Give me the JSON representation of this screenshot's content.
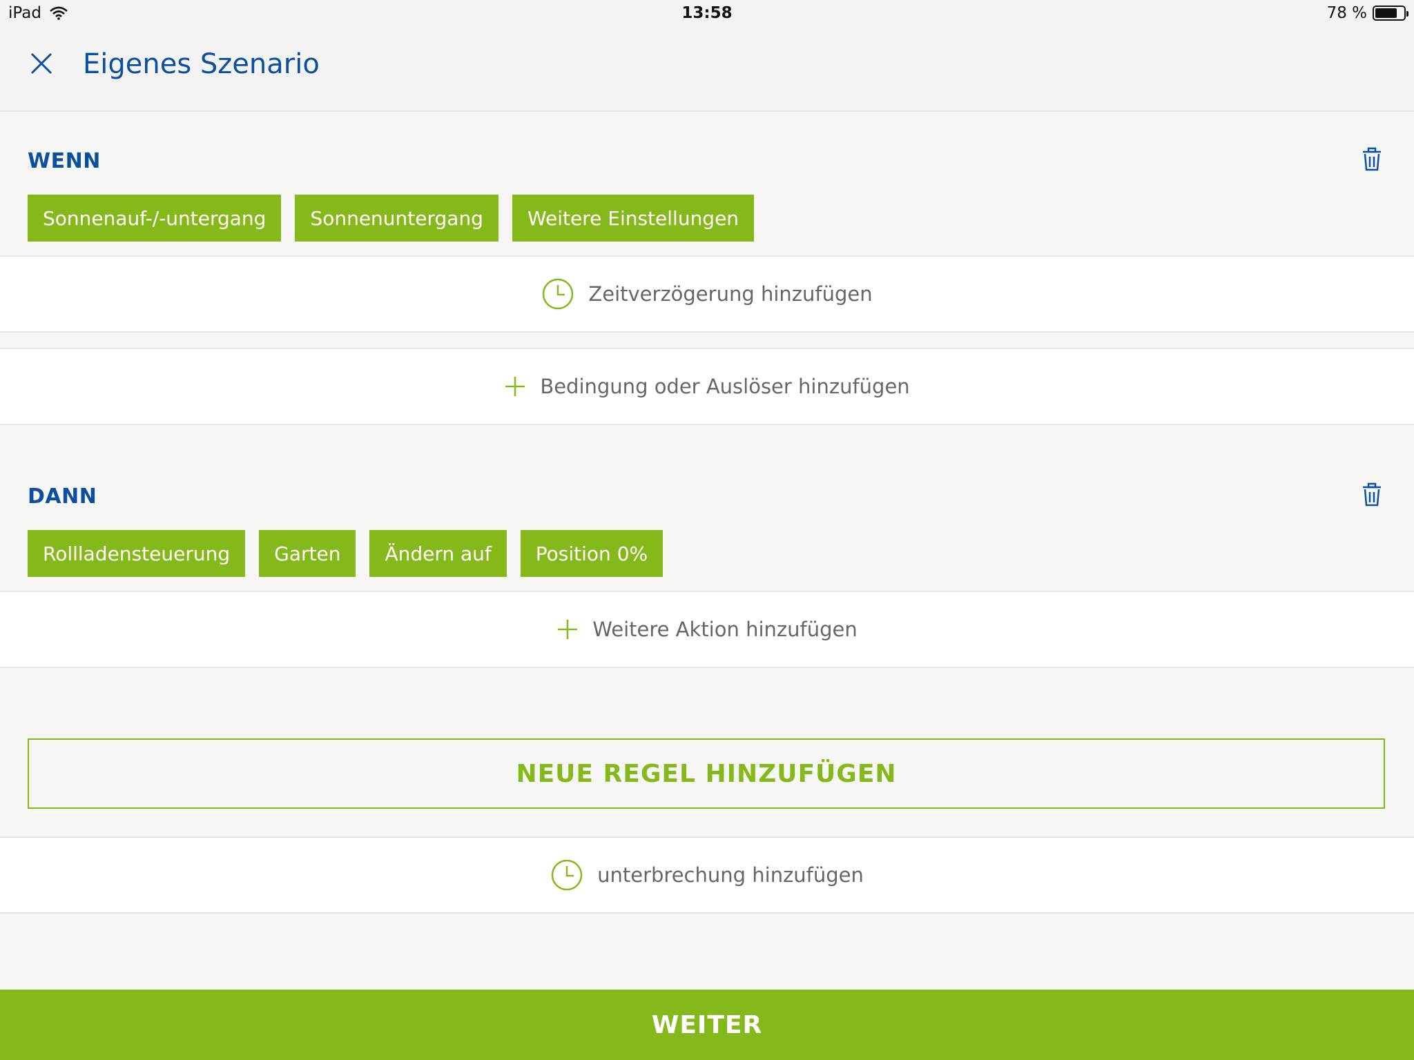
{
  "status_bar": {
    "device": "iPad",
    "time": "13:58",
    "battery": "78 %",
    "battery_level": 0.78
  },
  "header": {
    "title": "Eigenes Szenario",
    "close_icon": "close-icon"
  },
  "wenn": {
    "label": "WENN",
    "chips": [
      "Sonnenauf-/-untergang",
      "Sonnenuntergang",
      "Weitere Einstellungen"
    ],
    "add_delay": "Zeitverzögerung hinzufügen",
    "add_condition": "Bedingung oder Auslöser hinzufügen"
  },
  "dann": {
    "label": "DANN",
    "chips": [
      "Rollladensteuerung",
      "Garten",
      "Ändern auf",
      "Position 0%"
    ],
    "add_action": "Weitere Aktion hinzufügen"
  },
  "new_rule_label": "NEUE REGEL HINZUFÜGEN",
  "add_interruption": "unterbrechung hinzufügen",
  "continue_label": "WEITER",
  "colors": {
    "accent_green": "#85b81a",
    "primary_blue": "#0a4fa0",
    "background": "#f6f6f5"
  }
}
